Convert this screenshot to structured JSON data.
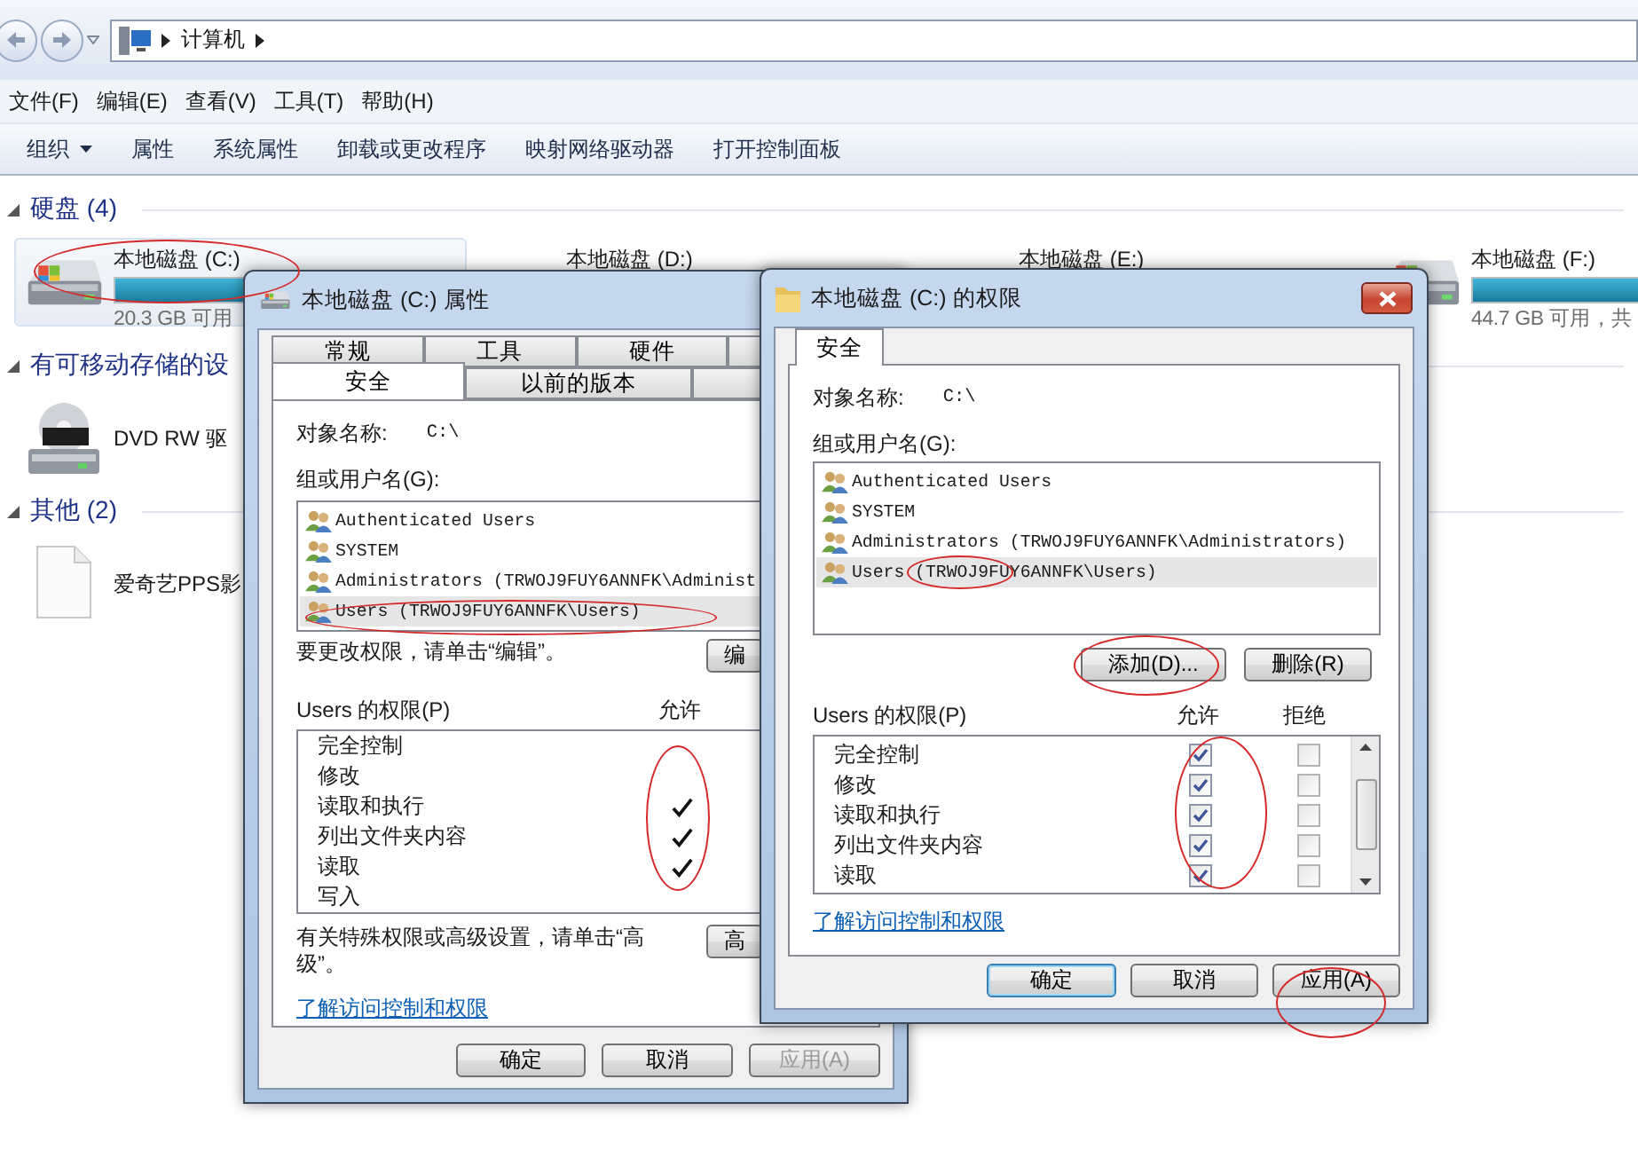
{
  "explorer": {
    "address": {
      "path": [
        "计算机"
      ]
    },
    "menu": [
      "文件(F)",
      "编辑(E)",
      "查看(V)",
      "工具(T)",
      "帮助(H)"
    ],
    "toolbar": [
      {
        "label": "组织",
        "dropdown": true
      },
      {
        "label": "属性",
        "dropdown": false
      },
      {
        "label": "系统属性",
        "dropdown": false
      },
      {
        "label": "卸载或更改程序",
        "dropdown": false
      },
      {
        "label": "映射网络驱动器",
        "dropdown": false
      },
      {
        "label": "打开控制面板",
        "dropdown": false
      }
    ],
    "groups": [
      {
        "title": "硬盘 (4)",
        "expanded": true,
        "items": [
          {
            "kind": "drive",
            "label": "本地磁盘 (C:)",
            "level": 0.85,
            "free": "20.3 GB 可用",
            "selected": true,
            "circled": true
          },
          {
            "kind": "covered_drive",
            "label": "本地磁盘 (D:)",
            "selected": false,
            "circled": false
          },
          {
            "kind": "covered_drive",
            "label": "本地磁盘 (E:)",
            "selected": false,
            "circled": false
          },
          {
            "kind": "drive",
            "label": "本地磁盘 (F:)",
            "level": 0.78,
            "free": "44.7 GB 可用，共",
            "selected": false,
            "circled": false
          }
        ]
      },
      {
        "title": "有可移动存储的设",
        "expanded": true,
        "items": [
          {
            "kind": "dvd",
            "label": "DVD RW 驱",
            "selected": false,
            "circled": false
          }
        ]
      },
      {
        "title": "其他 (2)",
        "expanded": true,
        "items": [
          {
            "kind": "file",
            "label": "爱奇艺PPS影",
            "selected": false,
            "circled": false
          }
        ]
      }
    ]
  },
  "properties_dialog": {
    "title": "本地磁盘 (C:) 属性",
    "tabs_back_row": [
      {
        "label": "常规",
        "selected": false
      },
      {
        "label": "工具",
        "selected": false
      },
      {
        "label": "硬件",
        "selected": false
      }
    ],
    "tabs_front_row": [
      {
        "label": "安全",
        "selected": true
      },
      {
        "label": "以前的版本",
        "selected": false
      }
    ],
    "object_label": "对象名称:",
    "object_value": "C:\\",
    "groups_label": "组或用户名(G):",
    "principals": [
      {
        "name": "Authenticated Users",
        "selected": false,
        "circled": false
      },
      {
        "name": "SYSTEM",
        "selected": false,
        "circled": false
      },
      {
        "name": "Administrators (TRWOJ9FUY6ANNFK\\Administ",
        "selected": false,
        "circled": false
      },
      {
        "name": "Users (TRWOJ9FUY6ANNFK\\Users)",
        "selected": true,
        "circled": true
      }
    ],
    "edit_hint": "要更改权限，请单击“编辑”。",
    "edit_button": "编",
    "permissions_label": "Users 的权限(P)",
    "allow_header": "允许",
    "allow_circled": true,
    "permissions": [
      {
        "name": "完全控制",
        "allow": false
      },
      {
        "name": "修改",
        "allow": false
      },
      {
        "name": "读取和执行",
        "allow": true
      },
      {
        "name": "列出文件夹内容",
        "allow": true
      },
      {
        "name": "读取",
        "allow": true
      },
      {
        "name": "写入",
        "allow": false
      }
    ],
    "advanced_hint": "有关特殊权限或高级设置，请单击“高级”。",
    "advanced_button": "高",
    "link": "了解访问控制和权限",
    "buttons": [
      {
        "label": "确定",
        "disabled": false,
        "default": false,
        "circled": false
      },
      {
        "label": "取消",
        "disabled": false,
        "default": false,
        "circled": false
      },
      {
        "label": "应用(A)",
        "disabled": true,
        "default": false,
        "circled": false
      }
    ]
  },
  "permissions_dialog": {
    "title": "本地磁盘 (C:) 的权限",
    "tabs": [
      {
        "label": "安全",
        "selected": true
      }
    ],
    "object_label": "对象名称:",
    "object_value": "C:\\",
    "groups_label": "组或用户名(G):",
    "principals": [
      {
        "name": "Authenticated Users",
        "selected": false,
        "circled": false
      },
      {
        "name": "SYSTEM",
        "selected": false,
        "circled": false
      },
      {
        "name": "Administrators (TRWOJ9FUY6ANNFK\\Administrators)",
        "selected": false,
        "circled": false
      },
      {
        "name": "Users (TRWOJ9FUY6ANNFK\\Users)",
        "selected": true,
        "circled": true
      }
    ],
    "list_buttons": [
      {
        "label": "添加(D)...",
        "circled": true
      },
      {
        "label": "删除(R)",
        "circled": false
      }
    ],
    "permissions_label": "Users 的权限(P)",
    "allow_header": "允许",
    "deny_header": "拒绝",
    "allow_circled": true,
    "permissions": [
      {
        "name": "完全控制",
        "allow": true,
        "deny": false
      },
      {
        "name": "修改",
        "allow": true,
        "deny": false
      },
      {
        "name": "读取和执行",
        "allow": true,
        "deny": false
      },
      {
        "name": "列出文件夹内容",
        "allow": true,
        "deny": false
      },
      {
        "name": "读取",
        "allow": true,
        "deny": false
      }
    ],
    "link": "了解访问控制和权限",
    "buttons": [
      {
        "label": "确定",
        "disabled": false,
        "default": true,
        "circled": false
      },
      {
        "label": "取消",
        "disabled": false,
        "default": false,
        "circled": false
      },
      {
        "label": "应用(A)",
        "disabled": false,
        "default": false,
        "circled": true
      }
    ]
  }
}
